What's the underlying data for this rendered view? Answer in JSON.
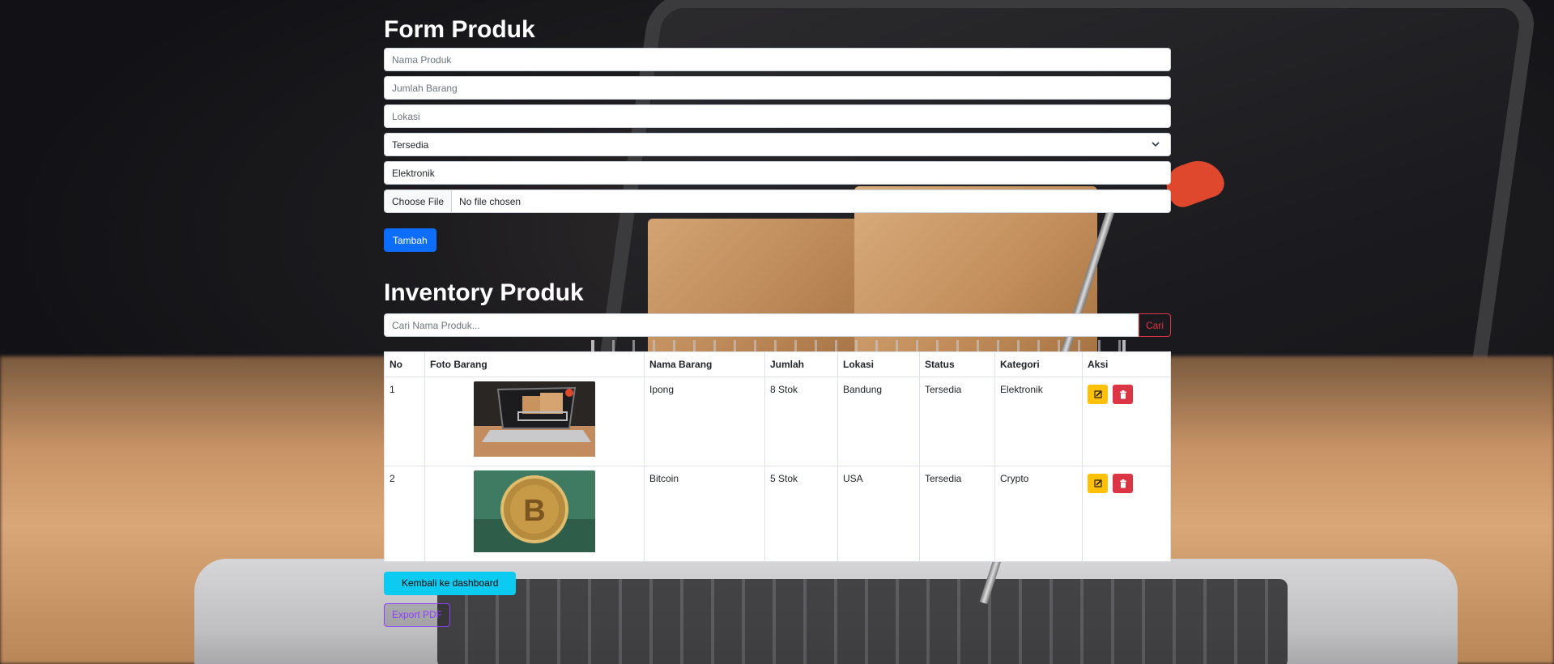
{
  "form": {
    "title": "Form Produk",
    "nama_placeholder": "Nama Produk",
    "jumlah_placeholder": "Jumlah Barang",
    "lokasi_placeholder": "Lokasi",
    "status_value": "Tersedia",
    "kategori_value": "Elektronik",
    "file_button": "Choose File",
    "file_status": "No file chosen",
    "submit_label": "Tambah"
  },
  "inventory": {
    "title": "Inventory Produk",
    "search_placeholder": "Cari Nama Produk...",
    "search_button": "Cari",
    "columns": [
      "No",
      "Foto Barang",
      "Nama Barang",
      "Jumlah",
      "Lokasi",
      "Status",
      "Kategori",
      "Aksi"
    ],
    "rows": [
      {
        "no": "1",
        "nama": "Ipong",
        "jumlah": "8 Stok",
        "lokasi": "Bandung",
        "status": "Tersedia",
        "kategori": "Elektronik",
        "photo": "laptop-cart-photo"
      },
      {
        "no": "2",
        "nama": "Bitcoin",
        "jumlah": "5 Stok",
        "lokasi": "USA",
        "status": "Tersedia",
        "kategori": "Crypto",
        "photo": "bitcoin-coin-photo"
      }
    ]
  },
  "actions": {
    "back_label": "Kembali ke dashboard",
    "export_label": "Export PDF"
  },
  "colors": {
    "primary": "#0d6efd",
    "warning": "#ffc107",
    "danger": "#dc3545",
    "info": "#0dcaf0",
    "purple": "#8a3ffc"
  }
}
